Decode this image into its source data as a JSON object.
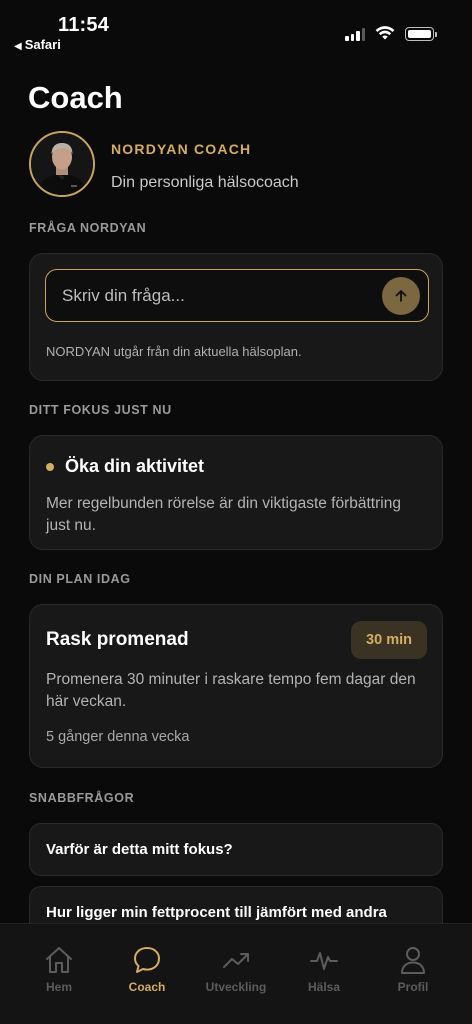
{
  "status_bar": {
    "time": "11:54",
    "back_app": "Safari",
    "caret": "◀"
  },
  "page": {
    "title": "Coach"
  },
  "coach": {
    "name": "NORDYAN COACH",
    "subtitle": "Din personliga hälsocoach"
  },
  "ask": {
    "section_label": "FRÅGA NORDYAN",
    "placeholder": "Skriv din fråga...",
    "note": "NORDYAN utgår från din aktuella hälsoplan."
  },
  "focus": {
    "section_label": "DITT FOKUS JUST NU",
    "title": "Öka din aktivitet",
    "body": "Mer regelbunden rörelse är din viktigaste förbättring just nu."
  },
  "plan": {
    "section_label": "DIN PLAN IDAG",
    "title": "Rask promenad",
    "badge": "30 min",
    "body": "Promenera 30 minuter i raskare tempo fem dagar den här veckan.",
    "count": "5 gånger denna vecka"
  },
  "quick": {
    "section_label": "SNABBFRÅGOR",
    "items": [
      "Varför är detta mitt fokus?",
      "Hur ligger min fettprocent till jämfört med andra"
    ]
  },
  "tabs": [
    {
      "label": "Hem",
      "icon": "home-icon"
    },
    {
      "label": "Coach",
      "icon": "chat-bubble-icon"
    },
    {
      "label": "Utveckling",
      "icon": "trend-up-icon"
    },
    {
      "label": "Hälsa",
      "icon": "heartbeat-icon"
    },
    {
      "label": "Profil",
      "icon": "person-icon"
    }
  ],
  "active_tab": "Coach",
  "colors": {
    "accent": "#d4ad62",
    "background": "#0a0a0a",
    "card": "#181818"
  }
}
